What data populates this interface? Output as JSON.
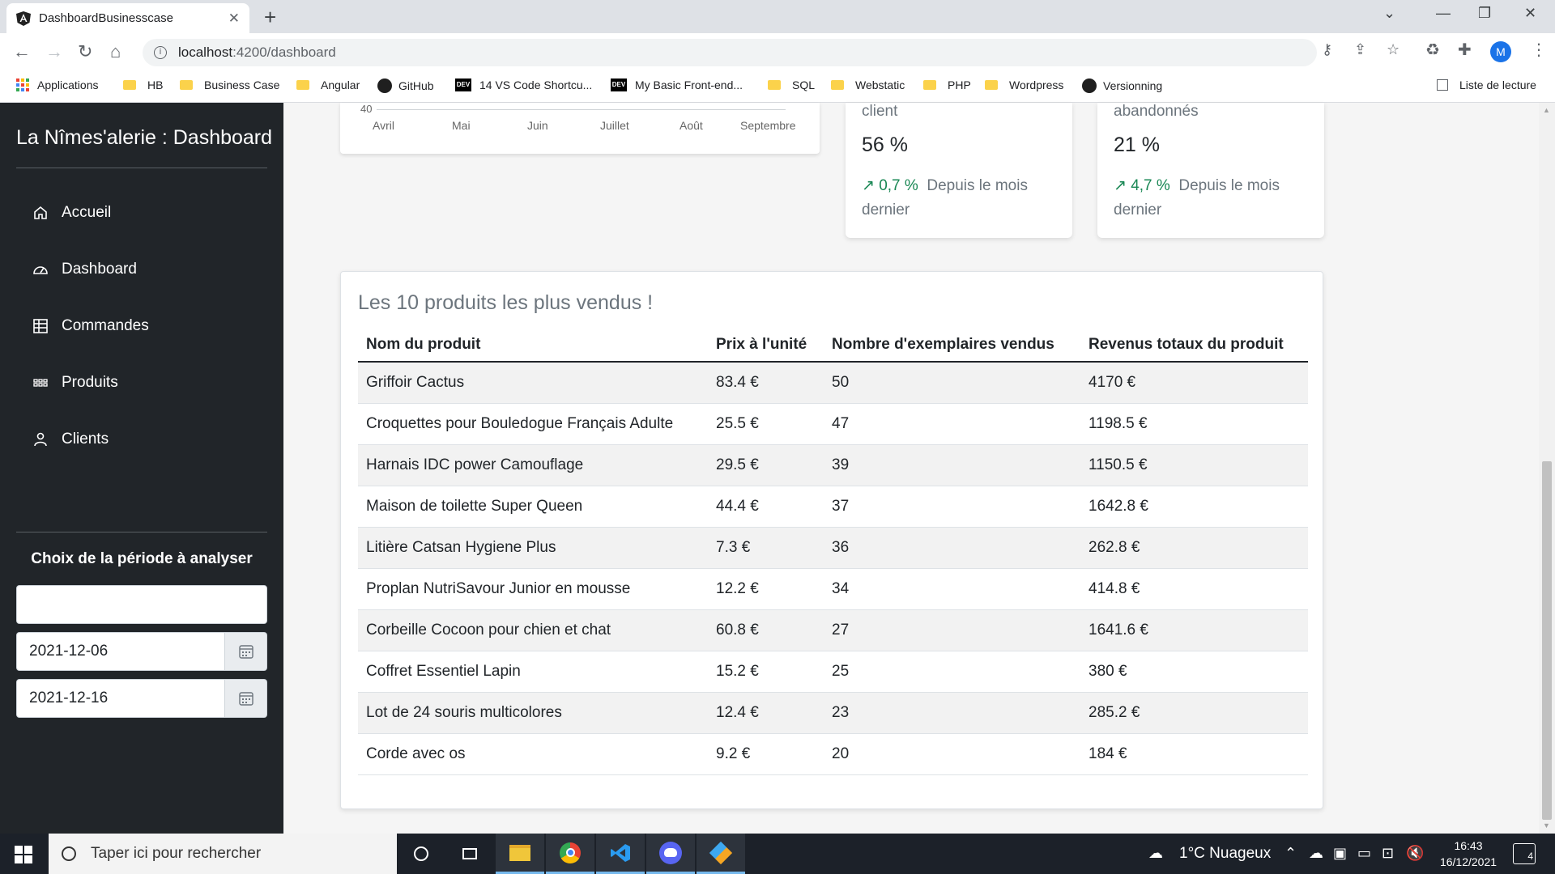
{
  "browser": {
    "tab_title": "DashboardBusinesscase",
    "url_host": "localhost",
    "url_rest": ":4200/dashboard",
    "bookmarks": [
      {
        "label": "Applications",
        "icon": "apps-grid-icon"
      },
      {
        "label": "HB",
        "icon": "folder-icon"
      },
      {
        "label": "Business Case",
        "icon": "folder-icon"
      },
      {
        "label": "Angular",
        "icon": "folder-icon"
      },
      {
        "label": "GitHub",
        "icon": "github-icon"
      },
      {
        "label": "14 VS Code Shortcu...",
        "icon": "dev-icon"
      },
      {
        "label": "My Basic Front-end...",
        "icon": "dev-icon"
      },
      {
        "label": "SQL",
        "icon": "folder-icon"
      },
      {
        "label": "Webstatic",
        "icon": "folder-icon"
      },
      {
        "label": "PHP",
        "icon": "folder-icon"
      },
      {
        "label": "Wordpress",
        "icon": "folder-icon"
      },
      {
        "label": "Versionning",
        "icon": "github-icon"
      }
    ],
    "reading_list": "Liste de lecture",
    "profile_initial": "M"
  },
  "sidebar": {
    "brand": "La Nîmes'alerie : Dashboard",
    "items": [
      {
        "label": "Accueil",
        "icon": "home-icon"
      },
      {
        "label": "Dashboard",
        "icon": "speedometer-icon"
      },
      {
        "label": "Commandes",
        "icon": "table-icon"
      },
      {
        "label": "Produits",
        "icon": "grid-icon"
      },
      {
        "label": "Clients",
        "icon": "person-icon"
      }
    ],
    "period_title": "Choix de la période à analyser",
    "period_value": "",
    "date_start": "2021-12-06",
    "date_end": "2021-12-16"
  },
  "chart": {
    "y_tick": "40",
    "months": [
      "Avril",
      "Mai",
      "Juin",
      "Juillet",
      "Août",
      "Septembre"
    ]
  },
  "stats": [
    {
      "title": "client",
      "value": "56 %",
      "trend": "↗ 0,7 %",
      "trend_text": "Depuis le mois dernier"
    },
    {
      "title": "abandonnés",
      "value": "21 %",
      "trend": "↗ 4,7 %",
      "trend_text": "Depuis le mois dernier"
    }
  ],
  "top_products": {
    "title": "Les 10 produits les plus vendus !",
    "columns": [
      "Nom du produit",
      "Prix à l'unité",
      "Nombre d'exemplaires vendus",
      "Revenus totaux du produit"
    ],
    "rows": [
      [
        "Griffoir Cactus",
        "83.4 €",
        "50",
        "4170 €"
      ],
      [
        "Croquettes pour Bouledogue Français Adulte",
        "25.5 €",
        "47",
        "1198.5 €"
      ],
      [
        "Harnais IDC power Camouflage",
        "29.5 €",
        "39",
        "1150.5 €"
      ],
      [
        "Maison de toilette Super Queen",
        "44.4 €",
        "37",
        "1642.8 €"
      ],
      [
        "Litière Catsan Hygiene Plus",
        "7.3 €",
        "36",
        "262.8 €"
      ],
      [
        "Proplan NutriSavour Junior en mousse",
        "12.2 €",
        "34",
        "414.8 €"
      ],
      [
        "Corbeille Cocoon pour chien et chat",
        "60.8 €",
        "27",
        "1641.6 €"
      ],
      [
        "Coffret Essentiel Lapin",
        "15.2 €",
        "25",
        "380 €"
      ],
      [
        "Lot de 24 souris multicolores",
        "12.4 €",
        "23",
        "285.2 €"
      ],
      [
        "Corde avec os",
        "9.2 €",
        "20",
        "184 €"
      ]
    ]
  },
  "taskbar": {
    "search_placeholder": "Taper ici pour rechercher",
    "weather": "1°C  Nuageux",
    "time": "16:43",
    "date": "16/12/2021",
    "notification_count": "4"
  }
}
